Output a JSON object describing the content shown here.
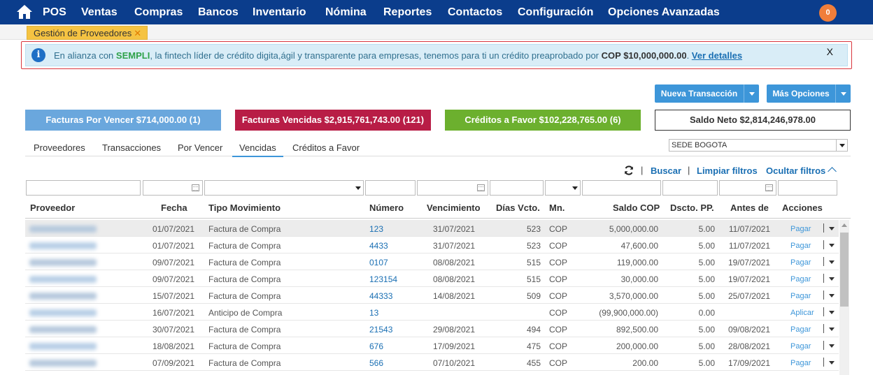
{
  "topnav": {
    "items": [
      "POS",
      "Ventas",
      "Compras",
      "Bancos",
      "Inventario",
      "Nómina",
      "Reportes",
      "Contactos",
      "Configuración",
      "Opciones Avanzadas"
    ],
    "notifications": "0",
    "bar_color": "#0b3d8c"
  },
  "tabstrip": {
    "active_tab": "Gestión de Proveedores",
    "close_glyph": "✕"
  },
  "alert": {
    "text_1": "En alianza con ",
    "brand": "SEMPLI",
    "text_2": ", la fintech líder de crédito digita,ágil y transparente para empresas, tenemos para ti un crédito preaprobado por ",
    "amount": "COP $10,000,000.00",
    "text_3": ". ",
    "link": "Ver detalles",
    "close": "X",
    "info_glyph": "i"
  },
  "actions": {
    "new_transaction": "Nueva Transacción",
    "more_options": "Más Opciones"
  },
  "summary": {
    "por_vencer": "Facturas Por Vencer $714,000.00 (1)",
    "vencidas": "Facturas Vencidas $2,915,761,743.00 (121)",
    "creditos": "Créditos a Favor $102,228,765.00 (6)",
    "saldo_neto": "Saldo Neto $2,814,246,978.00"
  },
  "subtabs": [
    "Proveedores",
    "Transacciones",
    "Por Vencer",
    "Vencidas",
    "Créditos a Favor"
  ],
  "active_subtab": "Vencidas",
  "sede": {
    "selected": "SEDE BOGOTA"
  },
  "filters": {
    "separator": "|",
    "search": "Buscar",
    "clear": "Limpiar filtros",
    "hide": "Ocultar filtros"
  },
  "columns": [
    "Proveedor",
    "Fecha",
    "Tipo Movimiento",
    "Número",
    "Vencimiento",
    "Días Vcto.",
    "Mn.",
    "Saldo COP",
    "Dscto. PP.",
    "Antes de",
    "Acciones"
  ],
  "rows": [
    {
      "fecha": "01/07/2021",
      "tipo": "Factura de Compra",
      "numero": "123",
      "venc": "31/07/2021",
      "dias": "523",
      "mn": "COP",
      "saldo": "5,000,000.00",
      "dscto": "5.00",
      "antes": "11/07/2021",
      "accion": "Pagar"
    },
    {
      "fecha": "01/07/2021",
      "tipo": "Factura de Compra",
      "numero": "4433",
      "venc": "31/07/2021",
      "dias": "523",
      "mn": "COP",
      "saldo": "47,600.00",
      "dscto": "5.00",
      "antes": "11/07/2021",
      "accion": "Pagar"
    },
    {
      "fecha": "09/07/2021",
      "tipo": "Factura de Compra",
      "numero": "0107",
      "venc": "08/08/2021",
      "dias": "515",
      "mn": "COP",
      "saldo": "119,000.00",
      "dscto": "5.00",
      "antes": "19/07/2021",
      "accion": "Pagar"
    },
    {
      "fecha": "09/07/2021",
      "tipo": "Factura de Compra",
      "numero": "123154",
      "venc": "08/08/2021",
      "dias": "515",
      "mn": "COP",
      "saldo": "30,000.00",
      "dscto": "5.00",
      "antes": "19/07/2021",
      "accion": "Pagar"
    },
    {
      "fecha": "15/07/2021",
      "tipo": "Factura de Compra",
      "numero": "44333",
      "venc": "14/08/2021",
      "dias": "509",
      "mn": "COP",
      "saldo": "3,570,000.00",
      "dscto": "5.00",
      "antes": "25/07/2021",
      "accion": "Pagar"
    },
    {
      "fecha": "16/07/2021",
      "tipo": "Anticipo de Compra",
      "numero": "13",
      "venc": "",
      "dias": "",
      "mn": "COP",
      "saldo": "(99,900,000.00)",
      "dscto": "0.00",
      "antes": "",
      "accion": "Aplicar"
    },
    {
      "fecha": "30/07/2021",
      "tipo": "Factura de Compra",
      "numero": "21543",
      "venc": "29/08/2021",
      "dias": "494",
      "mn": "COP",
      "saldo": "892,500.00",
      "dscto": "5.00",
      "antes": "09/08/2021",
      "accion": "Pagar"
    },
    {
      "fecha": "18/08/2021",
      "tipo": "Factura de Compra",
      "numero": "676",
      "venc": "17/09/2021",
      "dias": "475",
      "mn": "COP",
      "saldo": "200,000.00",
      "dscto": "5.00",
      "antes": "28/08/2021",
      "accion": "Pagar"
    },
    {
      "fecha": "07/09/2021",
      "tipo": "Factura de Compra",
      "numero": "566",
      "venc": "07/10/2021",
      "dias": "455",
      "mn": "COP",
      "saldo": "200.00",
      "dscto": "5.00",
      "antes": "17/09/2021",
      "accion": "Pagar"
    }
  ]
}
